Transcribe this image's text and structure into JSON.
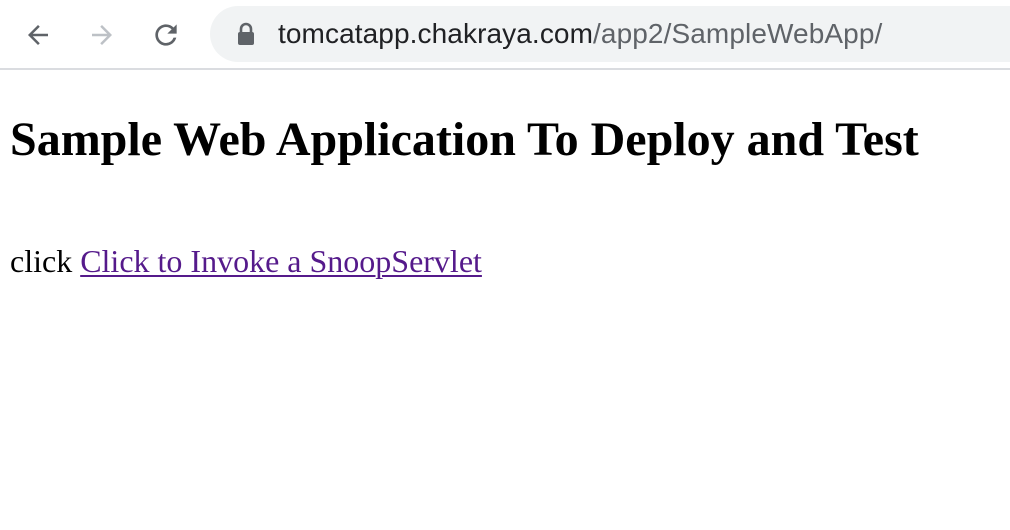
{
  "browser": {
    "url_host": "tomcatapp.chakraya.com",
    "url_path": "/app2/SampleWebApp/"
  },
  "page": {
    "heading": "Sample Web Application To Deploy and Test",
    "prefix_text": "click ",
    "link_text": "Click to Invoke a SnoopServlet"
  }
}
